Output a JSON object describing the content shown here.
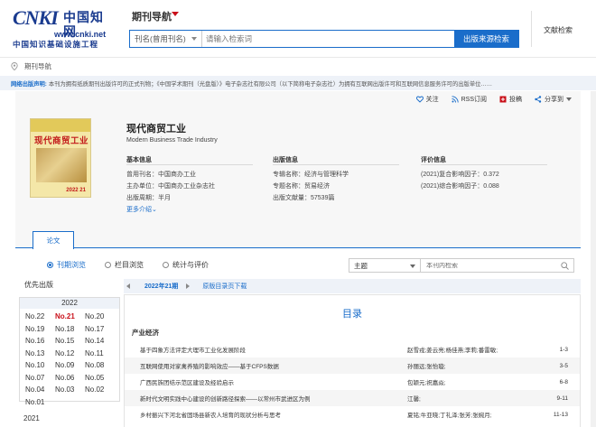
{
  "header": {
    "logo": {
      "brand": "CNKI",
      "chinese": "中国知网",
      "url": "www.cnki.net",
      "subtitle": "中国知识基础设施工程"
    },
    "nav_title": "期刊导航",
    "search": {
      "field_select": "刊名(曾用刊名)",
      "placeholder": "请输入检索词",
      "button": "出版来源检索"
    },
    "doc_search": "文献检索"
  },
  "breadcrumb": "期刊导航",
  "notice": {
    "label": "网络出版声明:",
    "text": "本刊为拥有纸质期刊出版许可的正式刊物；《中国学术期刊（光盘版）》电子杂志社有限公司（以下简称电子杂志社）为拥有互联网出版许可和互联网信息服务许可的出版单位……"
  },
  "journal": {
    "actions": [
      "关注",
      "RSS订阅",
      "投稿",
      "分享到"
    ],
    "cover": {
      "title": "现代商贸工业",
      "issue": "2022 21"
    },
    "title_cn": "现代商贸工业",
    "title_en": "Modern Business Trade Industry",
    "basic": {
      "head": "基本信息",
      "rows": [
        "曾用刊名：中国商办工业",
        "主办单位：中国商办工业杂志社",
        "出版周期：半月"
      ],
      "more": "更多介绍"
    },
    "publish": {
      "head": "出版信息",
      "rows": [
        "专辑名称：经济与管理科学",
        "专题名称：贸易经济",
        "出版文献量：57539篇"
      ]
    },
    "eval": {
      "head": "评价信息",
      "rows": [
        "(2021)复合影响因子：0.372",
        "(2021)综合影响因子：0.088"
      ]
    }
  },
  "tabs": {
    "active": "论文"
  },
  "browse": {
    "options": [
      "刊期浏览",
      "栏目浏览",
      "统计与评价"
    ],
    "selected": "刊期浏览",
    "filter": "主题",
    "search_placeholder": "本刊内检索"
  },
  "sidebar": {
    "title": "优先出版",
    "year": "2022",
    "issues": [
      "No.22",
      "No.21",
      "No.20",
      "No.19",
      "No.18",
      "No.17",
      "No.16",
      "No.15",
      "No.14",
      "No.13",
      "No.12",
      "No.11",
      "No.10",
      "No.09",
      "No.08",
      "No.07",
      "No.06",
      "No.05",
      "No.04",
      "No.03",
      "No.02",
      "No.01"
    ],
    "active_issue": "No.21",
    "prev_year": "2021"
  },
  "toc": {
    "issue_label": "2022年21期",
    "catalog_link": "原版目录页下载",
    "heading": "目录",
    "section": "产业经济",
    "rows": [
      {
        "title": "基于四象方法评定大理市工业化发展阶段",
        "authors": "赵雪戎;姜云亮;杨佳燕;李莉;番雷敏;",
        "pages": "1-3"
      },
      {
        "title": "互联网使用对家禽养殖的影响效应——基于CFPS数据",
        "authors": "孙丽远;张怡璇;",
        "pages": "3-5"
      },
      {
        "title": "广西民族团结示范区建设及经验启示",
        "authors": "包颖元;祝嘉焱;",
        "pages": "6-8"
      },
      {
        "title": "新时代文明实践中心建设的创新路径探索——以常州市武进区为例",
        "authors": "江馨;",
        "pages": "9-11"
      },
      {
        "title": "乡村振兴下河北省固场县新农人培育的现状分析与思考",
        "authors": "夏铭;牛亚晓;丁礼泽;张芳;张婉月;",
        "pages": "11-13"
      }
    ]
  }
}
